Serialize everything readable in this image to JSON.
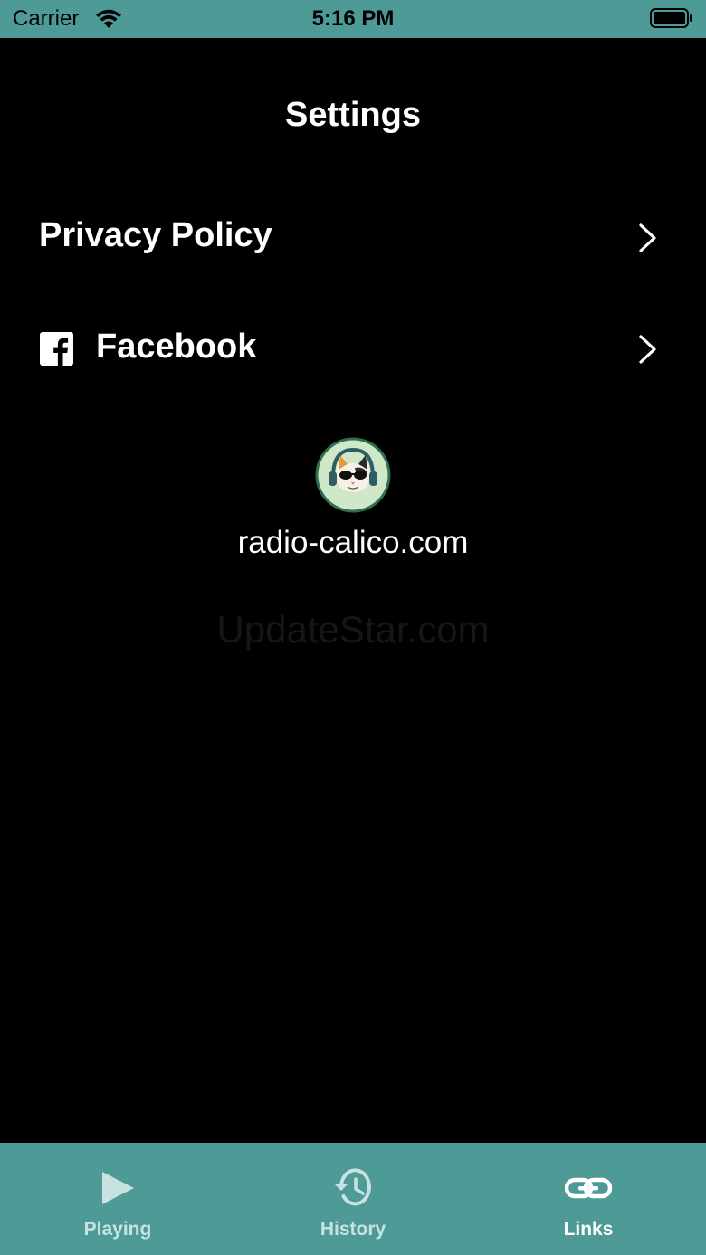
{
  "status_bar": {
    "carrier": "Carrier",
    "time": "5:16 PM",
    "icons": [
      "wifi-icon",
      "battery-icon"
    ]
  },
  "header": {
    "title": "Settings"
  },
  "settings": {
    "items": [
      {
        "label": "Privacy Policy",
        "icon": "chevron-right-icon"
      },
      {
        "label": "Facebook",
        "icon": "facebook-icon"
      }
    ]
  },
  "footer": {
    "logo": "radio-calico-logo",
    "site_link": "radio-calico.com"
  },
  "watermark": "UpdateStar.com",
  "tab_bar": {
    "tabs": [
      {
        "label": "Playing",
        "icon": "play-icon",
        "active": false
      },
      {
        "label": "History",
        "icon": "history-icon",
        "active": false
      },
      {
        "label": "Links",
        "icon": "link-icon",
        "active": true
      }
    ]
  },
  "colors": {
    "accent": "#4E9A97",
    "background": "#000000",
    "text": "#FFFFFF",
    "inactive_tab_text": "#C8E2E0"
  }
}
